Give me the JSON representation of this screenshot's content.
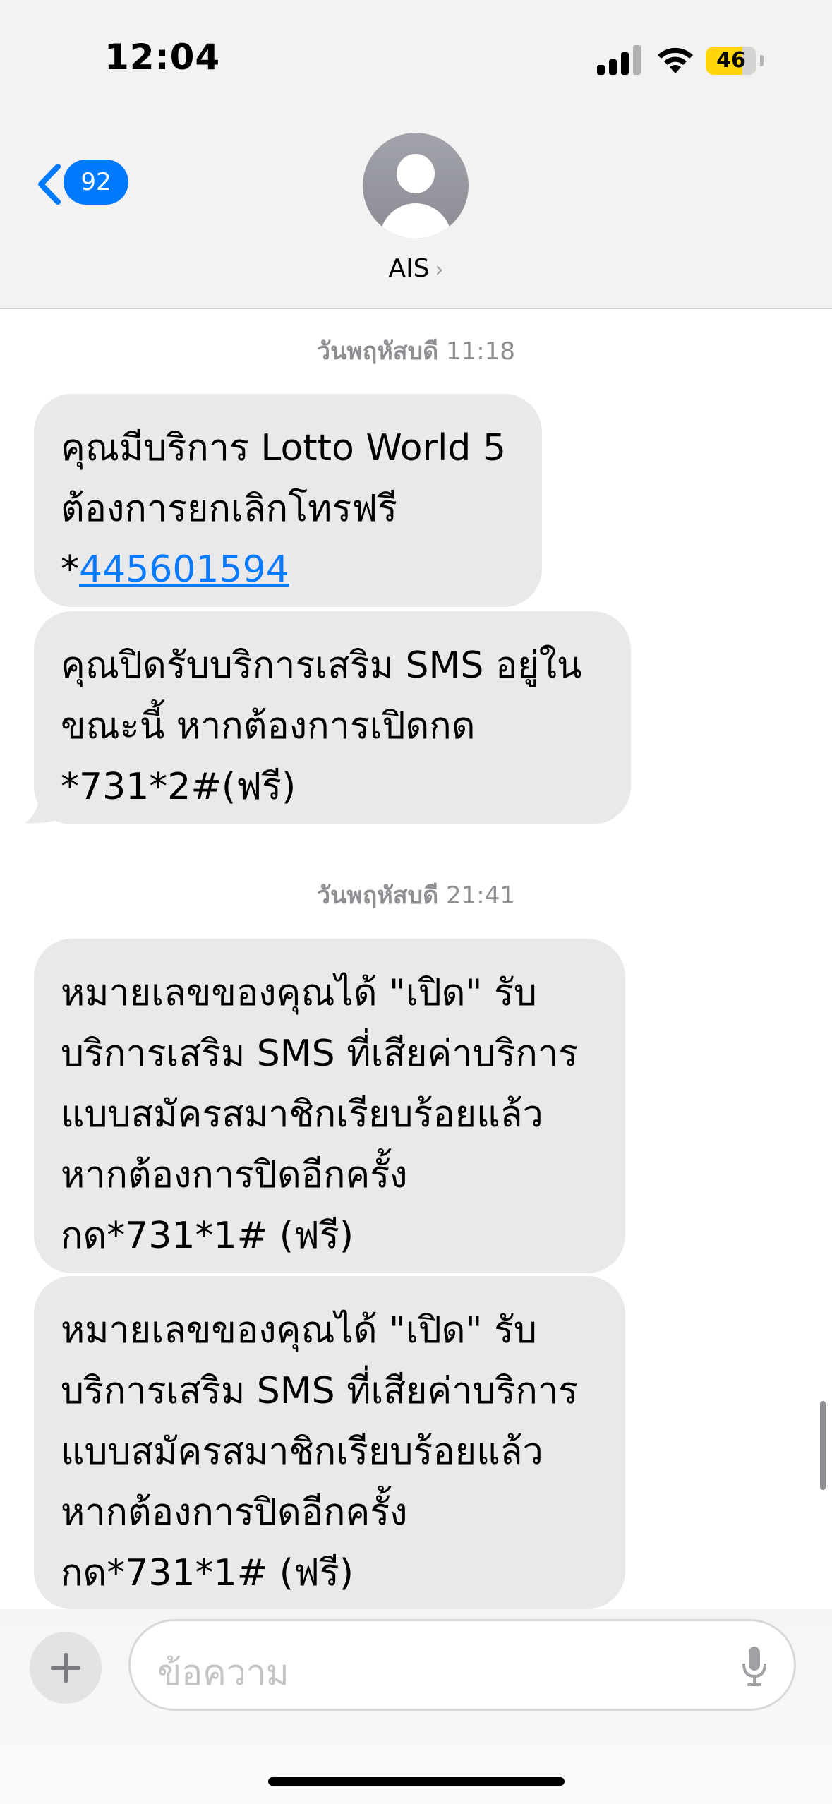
{
  "status_bar": {
    "time": "12:04",
    "battery_level": "46",
    "battery_color": "#ffd60a",
    "signal_icon": "cellular-signal-icon",
    "wifi_icon": "wifi-icon"
  },
  "header": {
    "back_count": "92",
    "contact_name": "AIS",
    "contact_chevron": "›",
    "accent_color": "#007aff"
  },
  "messages": {
    "group1_time_day": "วันพฤหัสบดี",
    "group1_time_clock": "11:18",
    "m1_text": "คุณมีบริการ Lotto World 5\nต้องการยกเลิกโทรฟรี\n*",
    "m1_link": "445601594",
    "m2_text": "คุณปิดรับบริการเสริม SMS อยู่ใน\nขณะนี้ หากต้องการเปิดกด\n*731*2#(ฟรี)",
    "group2_time_day": "วันพฤหัสบดี",
    "group2_time_clock": "21:41",
    "m3_text": "หมายเลขของคุณได้ \"เปิด\" รับ\nบริการเสริม SMS ที่เสียค่าบริการ\nแบบสมัครสมาชิกเรียบร้อยแล้ว\nหากต้องการปิดอีกครั้ง\nกด*731*1# (ฟรี)",
    "m4_text": "หมายเลขของคุณได้ \"เปิด\" รับ\nบริการเสริม SMS ที่เสียค่าบริการ\nแบบสมัครสมาชิกเรียบร้อยแล้ว\nหากต้องการปิดอีกครั้ง\nกด*731*1# (ฟรี)"
  },
  "compose": {
    "placeholder": "ข้อความ",
    "plus_icon": "plus-icon",
    "mic_icon": "microphone-icon"
  }
}
